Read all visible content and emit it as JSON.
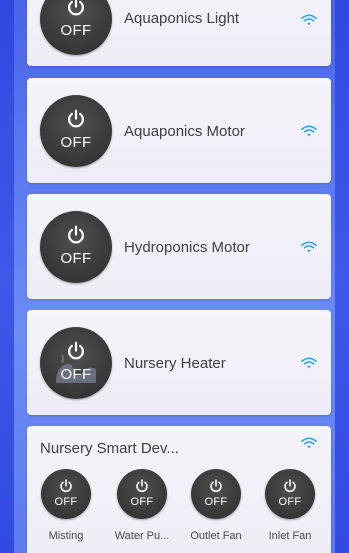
{
  "colors": {
    "accent_wifi": "#2aa7f0",
    "button_dark": "#3a3a3a",
    "card_bg": "#f3f1f8",
    "background": "#5b78f0"
  },
  "devices": [
    {
      "name": "Aquaponics Light",
      "state": "OFF",
      "icon": "power-icon",
      "status_icon": "wifi-icon"
    },
    {
      "name": "Aquaponics Motor",
      "state": "OFF",
      "icon": "power-icon",
      "status_icon": "wifi-icon"
    },
    {
      "name": "Hydroponics Motor",
      "state": "OFF",
      "icon": "power-icon",
      "status_icon": "wifi-icon"
    },
    {
      "name": "Nursery Heater",
      "state": "OFF",
      "icon": "power-icon",
      "status_icon": "wifi-icon"
    }
  ],
  "group": {
    "title": "Nursery Smart Dev...",
    "status_icon": "wifi-icon",
    "items": [
      {
        "label": "Misting",
        "state": "OFF"
      },
      {
        "label": "Water Pu...",
        "state": "OFF"
      },
      {
        "label": "Outlet Fan",
        "state": "OFF"
      },
      {
        "label": "Inlet Fan",
        "state": "OFF"
      }
    ]
  }
}
